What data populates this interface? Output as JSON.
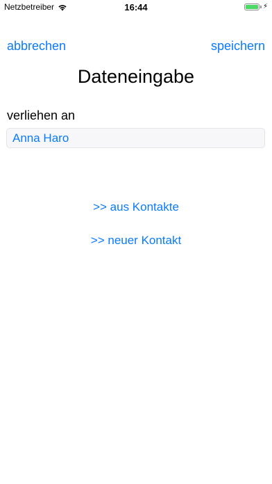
{
  "status_bar": {
    "carrier": "Netzbetreiber",
    "time": "16:44",
    "battery_level": 1.0,
    "battery_color": "#4cd964",
    "charging_icon": "bolt-icon",
    "wifi_icon": "wifi-icon"
  },
  "nav": {
    "cancel_label": "abbrechen",
    "save_label": "speichern"
  },
  "title": "Dateneingabe",
  "form": {
    "lent_to_label": "verliehen an",
    "lent_to_value": "Anna Haro"
  },
  "actions": {
    "from_contacts_label": ">> aus Kontakte",
    "new_contact_label": ">> neuer Kontakt"
  },
  "colors": {
    "accent": "#0a7aff",
    "field_background": "#f7f7f9"
  }
}
